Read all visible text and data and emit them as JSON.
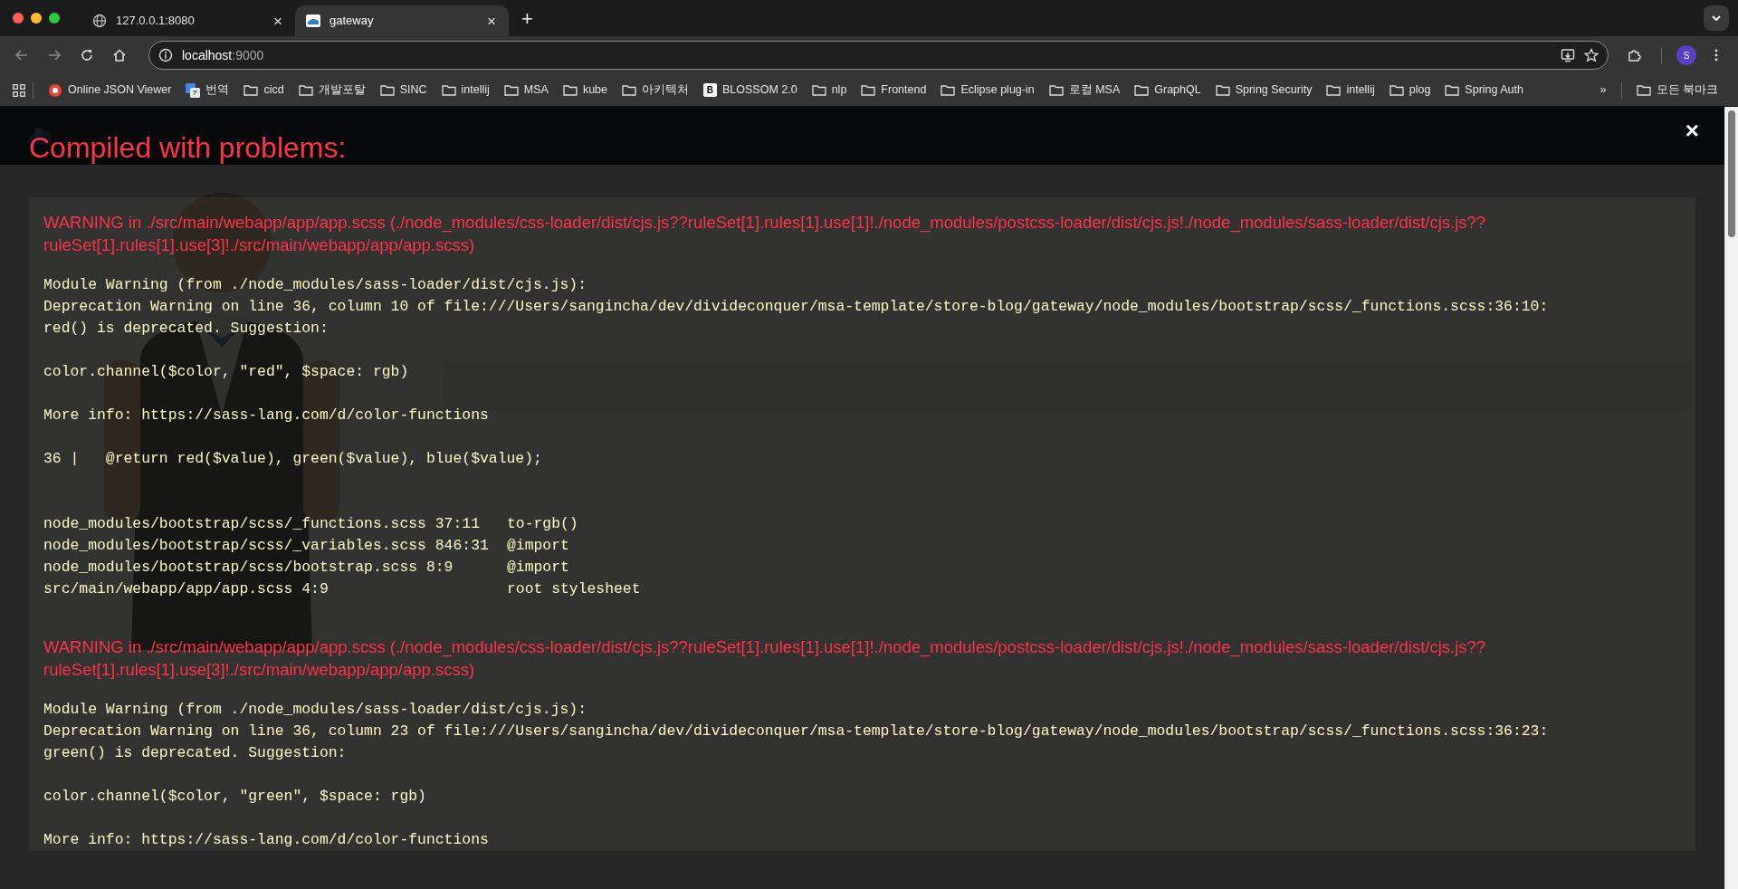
{
  "browser": {
    "tabs": [
      {
        "title": "127.0.0.1:8080",
        "close": "×",
        "selected": false
      },
      {
        "title": "gateway",
        "close": "×",
        "selected": true
      }
    ],
    "new_tab": "+",
    "address": {
      "host": "localhost",
      "port": ":9000"
    },
    "profile_initial": "S",
    "bookmarks": [
      {
        "label": "Online JSON Viewer",
        "kind": "json-viewer"
      },
      {
        "label": "번역",
        "kind": "translate"
      },
      {
        "label": "cicd",
        "kind": "folder"
      },
      {
        "label": "개발포탈",
        "kind": "folder"
      },
      {
        "label": "SINC",
        "kind": "folder"
      },
      {
        "label": "intellij",
        "kind": "folder"
      },
      {
        "label": "MSA",
        "kind": "folder"
      },
      {
        "label": "kube",
        "kind": "folder"
      },
      {
        "label": "아키텍처",
        "kind": "folder"
      },
      {
        "label": "BLOSSOM 2.0",
        "kind": "letter-badge",
        "badge": "B"
      },
      {
        "label": "nlp",
        "kind": "folder"
      },
      {
        "label": "Frontend",
        "kind": "folder"
      },
      {
        "label": "Eclipse plug-in",
        "kind": "folder"
      },
      {
        "label": "로컬 MSA",
        "kind": "folder"
      },
      {
        "label": "GraphQL",
        "kind": "folder"
      },
      {
        "label": "Spring Security",
        "kind": "folder"
      },
      {
        "label": "intellij",
        "kind": "folder"
      },
      {
        "label": "plog",
        "kind": "folder"
      },
      {
        "label": "Spring Auth",
        "kind": "folder"
      }
    ],
    "overflow": "»",
    "all_bookmarks": "모든 북마크"
  },
  "overlay": {
    "title": "Compiled with problems:",
    "close": "×",
    "problems": [
      {
        "heading": "WARNING in ./src/main/webapp/app/app.scss (./node_modules/css-loader/dist/cjs.js??ruleSet[1].rules[1].use[1]!./node_modules/postcss-loader/dist/cjs.js!./node_modules/sass-loader/dist/cjs.js??ruleSet[1].rules[1].use[3]!./src/main/webapp/app/app.scss)",
        "blocks": [
          [
            "Module Warning (from ./node_modules/sass-loader/dist/cjs.js):",
            "Deprecation Warning on line 36, column 10 of file:///Users/sangincha/dev/divideconquer/msa-template/store-blog/gateway/node_modules/bootstrap/scss/_functions.scss:36:10:",
            "red() is deprecated. Suggestion:"
          ],
          [
            "color.channel($color, \"red\", $space: rgb)"
          ],
          [
            "More info: https://sass-lang.com/d/color-functions"
          ],
          [
            "36 |   @return red($value), green($value), blue($value);"
          ]
        ],
        "stack": [
          {
            "location": "node_modules/bootstrap/scss/_functions.scss 37:11",
            "caller": "to-rgb()"
          },
          {
            "location": "node_modules/bootstrap/scss/_variables.scss 846:31",
            "caller": "@import"
          },
          {
            "location": "node_modules/bootstrap/scss/bootstrap.scss 8:9",
            "caller": "@import"
          },
          {
            "location": "src/main/webapp/app/app.scss 4:9",
            "caller": "root stylesheet"
          }
        ]
      },
      {
        "heading": "WARNING in ./src/main/webapp/app/app.scss (./node_modules/css-loader/dist/cjs.js??ruleSet[1].rules[1].use[1]!./node_modules/postcss-loader/dist/cjs.js!./node_modules/sass-loader/dist/cjs.js??ruleSet[1].rules[1].use[3]!./src/main/webapp/app/app.scss)",
        "blocks": [
          [
            "Module Warning (from ./node_modules/sass-loader/dist/cjs.js):",
            "Deprecation Warning on line 36, column 23 of file:///Users/sangincha/dev/divideconquer/msa-template/store-blog/gateway/node_modules/bootstrap/scss/_functions.scss:36:23:",
            "green() is deprecated. Suggestion:"
          ],
          [
            "color.channel($color, \"green\", $space: rgb)"
          ],
          [
            "More info: https://sass-lang.com/d/color-functions"
          ]
        ]
      }
    ]
  }
}
